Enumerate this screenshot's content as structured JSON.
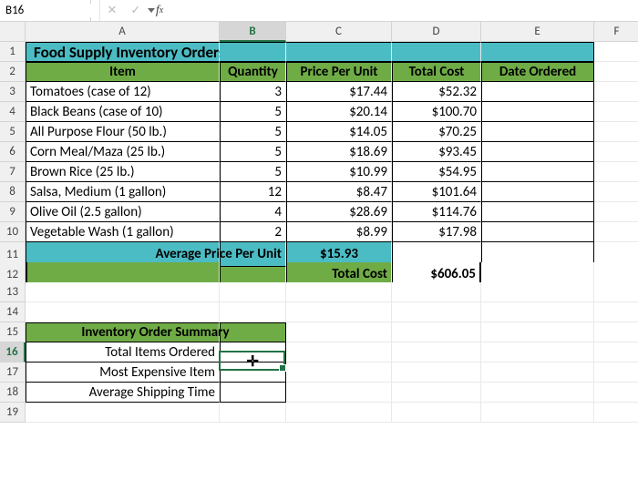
{
  "name_box": "B16",
  "formula_value": "",
  "columns": [
    "A",
    "B",
    "C",
    "D",
    "E",
    "F"
  ],
  "rows": [
    "1",
    "2",
    "3",
    "4",
    "5",
    "6",
    "7",
    "8",
    "9",
    "10",
    "11",
    "12",
    "13",
    "14",
    "15",
    "16",
    "17",
    "18",
    "19"
  ],
  "title": "Food Supply Inventory Orders (Non-Perishable Items)",
  "headers": {
    "item": "Item",
    "qty": "Quantity",
    "ppu": "Price Per Unit",
    "total": "Total Cost",
    "date": "Date Ordered"
  },
  "items": [
    {
      "name": "Tomatoes (case of 12)",
      "qty": "3",
      "ppu": "$17.44",
      "total": "$52.32"
    },
    {
      "name": "Black Beans (case of 10)",
      "qty": "5",
      "ppu": "$20.14",
      "total": "$100.70"
    },
    {
      "name": "All Purpose Flour (50 lb.)",
      "qty": "5",
      "ppu": "$14.05",
      "total": "$70.25"
    },
    {
      "name": "Corn Meal/Maza (25 lb.)",
      "qty": "5",
      "ppu": "$18.69",
      "total": "$93.45"
    },
    {
      "name": "Brown Rice (25 lb.)",
      "qty": "5",
      "ppu": "$10.99",
      "total": "$54.95"
    },
    {
      "name": "Salsa, Medium (1 gallon)",
      "qty": "12",
      "ppu": "$8.47",
      "total": "$101.64"
    },
    {
      "name": "Olive Oil (2.5 gallon)",
      "qty": "4",
      "ppu": "$28.69",
      "total": "$114.76"
    },
    {
      "name": "Vegetable Wash (1 gallon)",
      "qty": "2",
      "ppu": "$8.99",
      "total": "$17.98"
    }
  ],
  "avg_label": "Average Price Per Unit",
  "avg_value": "$15.93",
  "tot_label": "Total Cost",
  "tot_value": "$606.05",
  "summary_title": "Inventory Order Summary",
  "summary_rows": [
    "Total Items Ordered",
    "Most Expensive Item",
    "Average Shipping Time"
  ],
  "selected_col": "B",
  "selected_row": "16",
  "chart_data": {
    "type": "table",
    "title": "Food Supply Inventory Orders (Non-Perishable Items)",
    "columns": [
      "Item",
      "Quantity",
      "Price Per Unit",
      "Total Cost"
    ],
    "rows": [
      [
        "Tomatoes (case of 12)",
        3,
        17.44,
        52.32
      ],
      [
        "Black Beans (case of 10)",
        5,
        20.14,
        100.7
      ],
      [
        "All Purpose Flour (50 lb.)",
        5,
        14.05,
        70.25
      ],
      [
        "Corn Meal/Maza (25 lb.)",
        5,
        18.69,
        93.45
      ],
      [
        "Brown Rice (25 lb.)",
        5,
        10.99,
        54.95
      ],
      [
        "Salsa, Medium (1 gallon)",
        12,
        8.47,
        101.64
      ],
      [
        "Olive Oil (2.5 gallon)",
        4,
        28.69,
        114.76
      ],
      [
        "Vegetable Wash (1 gallon)",
        2,
        8.99,
        17.98
      ]
    ],
    "aggregate": {
      "average_price_per_unit": 15.93,
      "total_cost": 606.05
    }
  }
}
